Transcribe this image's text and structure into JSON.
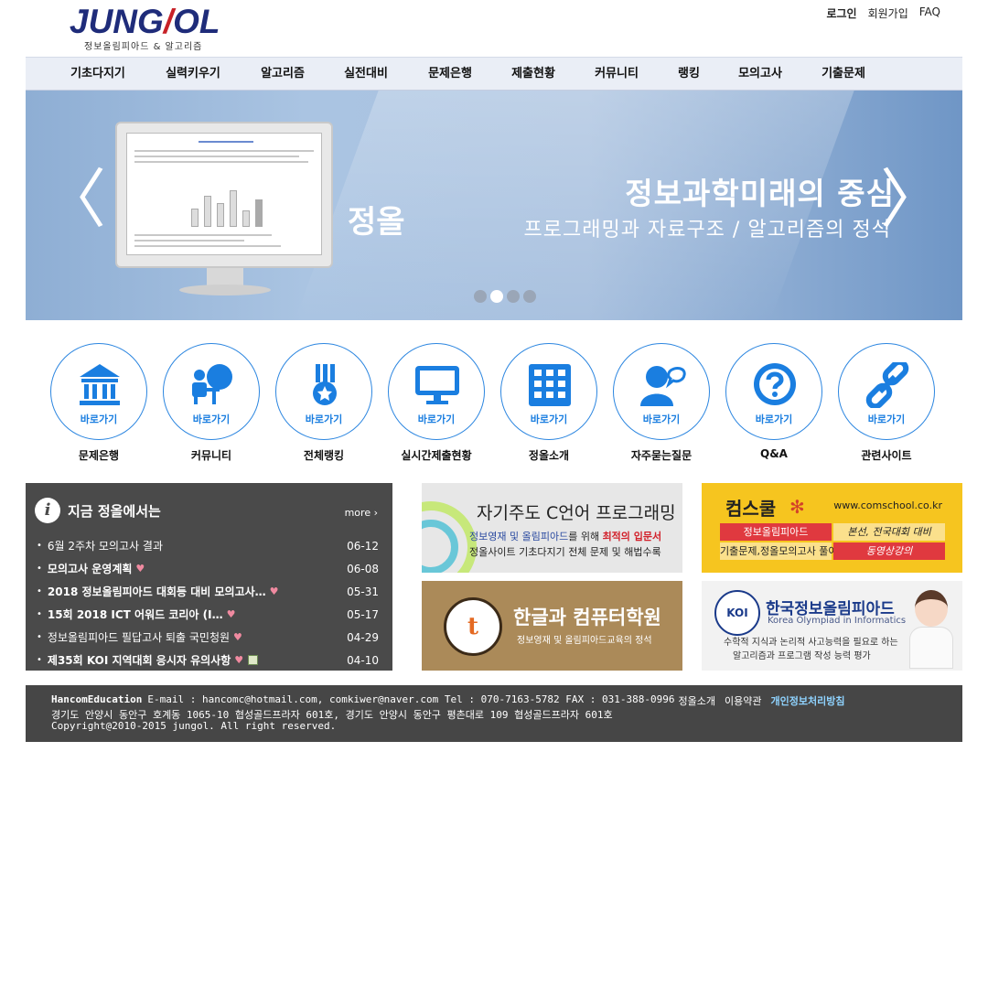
{
  "header": {
    "logo_text_a": "JUNG",
    "logo_text_b": "OL",
    "logo_sub": "정보올림피아드 & 알고리즘",
    "top_links": {
      "login": "로그인",
      "signup": "회원가입",
      "faq": "FAQ"
    }
  },
  "nav": {
    "items": [
      "기초다지기",
      "실력키우기",
      "알고리즘",
      "실전대비",
      "문제은행",
      "제출현황",
      "커뮤니티",
      "랭킹",
      "모의고사",
      "기출문제"
    ]
  },
  "banner": {
    "side_text": "정올",
    "title": "정보과학미래의 중심",
    "subtitle": "프로그래밍과 자료구조 / 알고리즘의 정석",
    "prev_arrow": "〈",
    "next_arrow": "〉",
    "slide_count": 4,
    "active_slide": 2
  },
  "quick_links": {
    "go_label": "바로가기",
    "items": [
      {
        "label": "문제은행",
        "icon": "bank-icon"
      },
      {
        "label": "커뮤니티",
        "icon": "community-icon"
      },
      {
        "label": "전체랭킹",
        "icon": "medal-icon"
      },
      {
        "label": "실시간제출현황",
        "icon": "monitor-icon"
      },
      {
        "label": "정올소개",
        "icon": "building-icon"
      },
      {
        "label": "자주묻는질문",
        "icon": "chat-user-icon"
      },
      {
        "label": "Q&A",
        "icon": "question-icon"
      },
      {
        "label": "관련사이트",
        "icon": "link-icon"
      }
    ]
  },
  "news": {
    "icon": "i",
    "title": "지금 정올에서는",
    "more": "more",
    "items": [
      {
        "title": "6월 2주차 모의고사 결과",
        "date": "06-12",
        "bold": false,
        "heart": false,
        "file": false
      },
      {
        "title": "모의고사 운영계획",
        "date": "06-08",
        "bold": true,
        "heart": true,
        "file": false
      },
      {
        "title": "2018 정보올림피아드 대회등 대비 모의고사…",
        "date": "05-31",
        "bold": true,
        "heart": true,
        "file": false
      },
      {
        "title": "15회 2018 ICT 어워드 코리아 (I…",
        "date": "05-17",
        "bold": true,
        "heart": true,
        "file": false
      },
      {
        "title": "정보올림피아드 필답고사 퇴출 국민청원",
        "date": "04-29",
        "bold": false,
        "heart": true,
        "file": false
      },
      {
        "title": "제35회 KOI 지역대회 응시자 유의사항",
        "date": "04-10",
        "bold": true,
        "heart": true,
        "file": true
      }
    ]
  },
  "ads": {
    "ad1": {
      "title": "자기주도 C언어 프로그래밍",
      "line1_a": "정보영재 및 올림피아드",
      "line1_b": "를 위해 ",
      "line1_c": "최적의 입문서",
      "line2": "정올사이트 기초다지기 전체 문제 및 해법수록"
    },
    "ad2": {
      "title": "컴스쿨",
      "url": "www.comschool.co.kr",
      "c1": "정보올림피아드",
      "c2": "본선, 전국대회 대비",
      "c3": "기출문제,정올모의고사 풀이",
      "c4": "동영상강의"
    },
    "ad3": {
      "emblem": "t",
      "title": "한글과 컴퓨터학원",
      "subtitle": "정보영재 및 올림피아드교육의 정석"
    },
    "ad4": {
      "badge": "KOI",
      "title": "한국정보올림피아드",
      "english": "Korea Olympiad in Informatics",
      "line1": "수학적 지식과 논리적 사고능력을 필요로 하는",
      "line2": "알고리즘과 프로그램 작성 능력 평가"
    }
  },
  "footer": {
    "brand": "HancomEducation",
    "contact": "E-mail : hancomc@hotmail.com, comkiwer@naver.com Tel : 070-7163-5782 FAX : 031-388-0996",
    "about": "정올소개",
    "terms": "이용약관",
    "privacy": "개인정보처리방침",
    "address": "경기도 안양시 동안구 호계동 1065-10 협성골드프라자 601호, 경기도 안양시 동안구 평촌대로 109 협성골드프라자 601호",
    "copyright": "Copyright@2010-2015 jungol. All right reserved."
  },
  "colors": {
    "accent_blue": "#1a7ee0",
    "nav_bg": "#eaeef6",
    "news_bg": "#4a4a4a",
    "footer_bg": "#464646",
    "privacy_link": "#8fd3ff"
  }
}
